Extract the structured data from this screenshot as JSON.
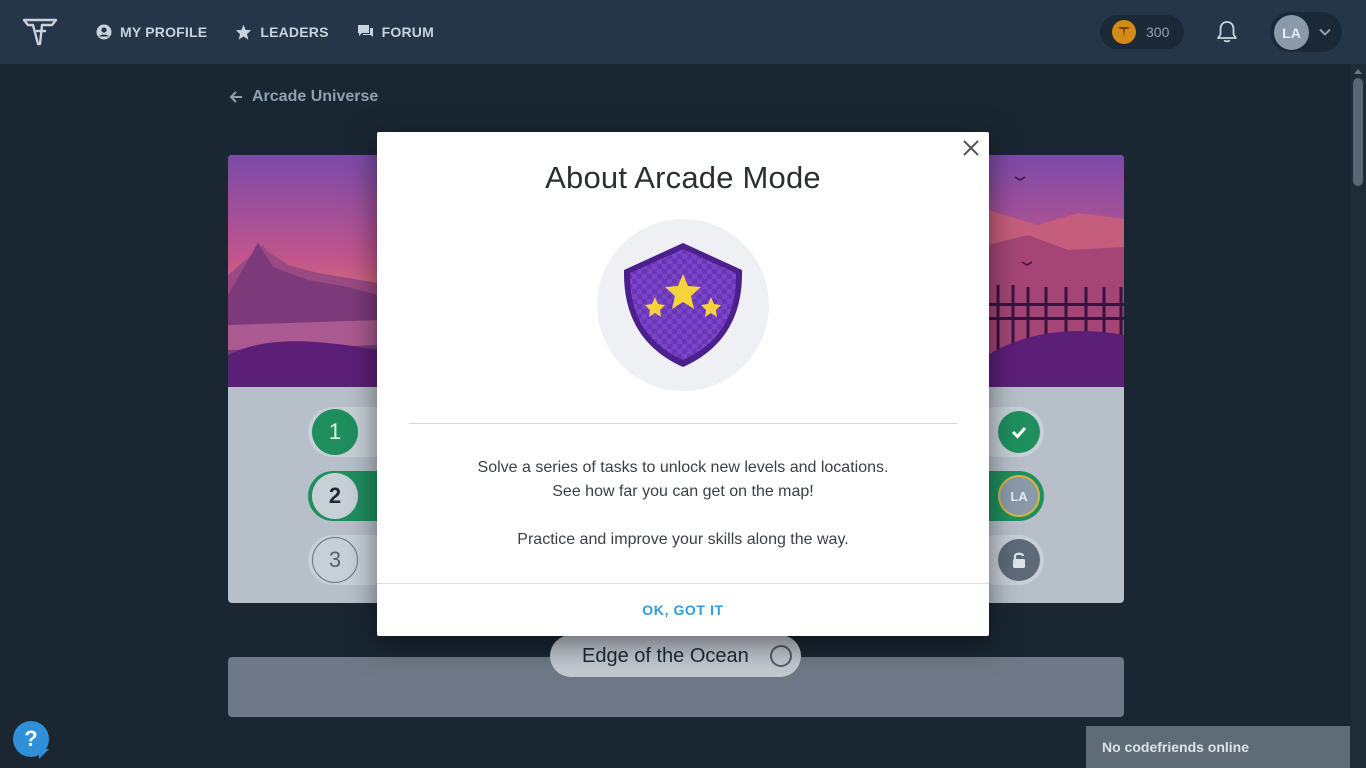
{
  "nav": {
    "items": [
      {
        "label": "MY PROFILE",
        "icon": "user-circle-icon"
      },
      {
        "label": "LEADERS",
        "icon": "star-icon"
      },
      {
        "label": "FORUM",
        "icon": "chat-icon"
      }
    ],
    "coins": "300",
    "avatar_initials": "LA"
  },
  "breadcrumb": {
    "label": "Arcade Universe"
  },
  "map": {
    "levels": [
      {
        "number": "1",
        "status": "completed"
      },
      {
        "number": "2",
        "status": "current",
        "avatar": "LA"
      },
      {
        "number": "3",
        "status": "locked"
      }
    ],
    "next_location": "Edge of the Ocean"
  },
  "friends": {
    "status": "No codefriends online"
  },
  "help": {
    "label": "?"
  },
  "modal": {
    "title": "About Arcade Mode",
    "line1": "Solve a series of tasks to unlock new levels and locations.",
    "line2": "See how far you can get on the map!",
    "line3": "Practice and improve your skills along the way.",
    "ok_label": "OK, GOT IT"
  },
  "colors": {
    "topbar": "#243647",
    "background": "#1a2733",
    "accent_green": "#1f8f5e",
    "link_blue": "#2f9be0",
    "badge_purple": "#6a35b8",
    "star_yellow": "#f6d33c"
  }
}
